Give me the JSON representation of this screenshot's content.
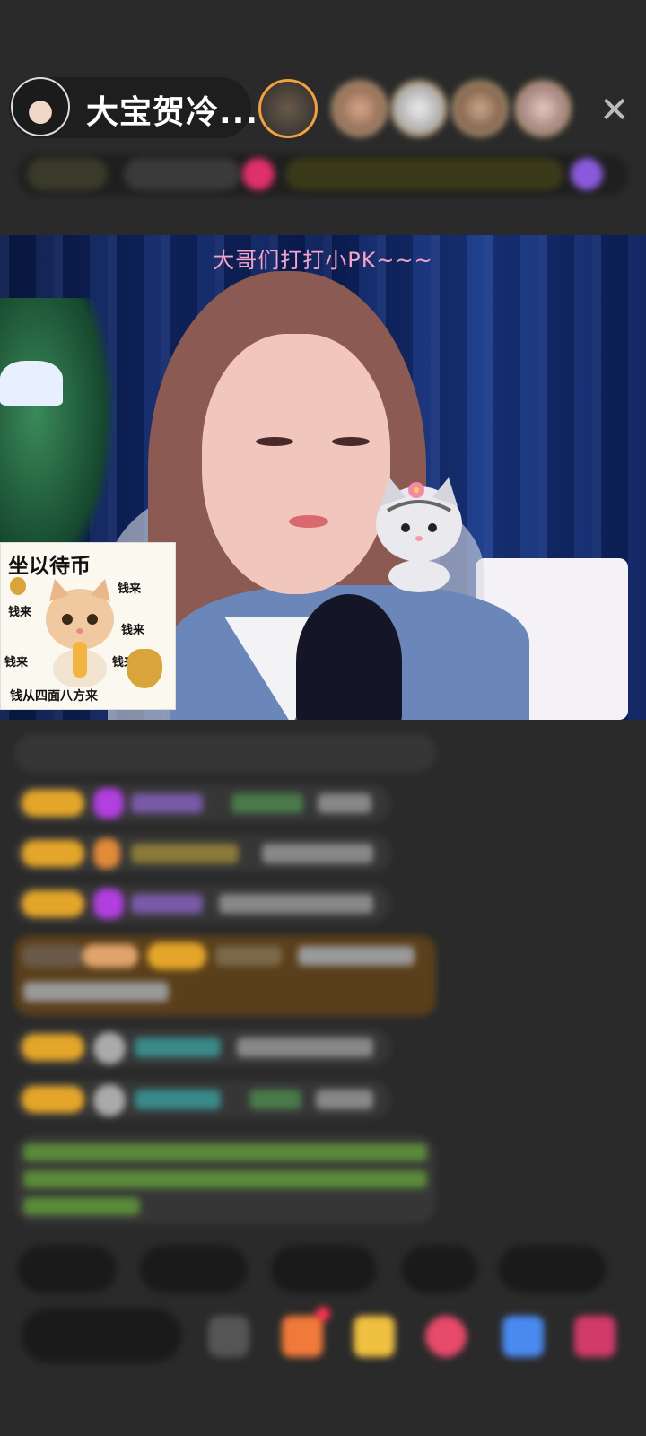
{
  "header": {
    "host_name": "大宝贺冷...",
    "close_icon": "close-icon",
    "viewer_count": 5
  },
  "video": {
    "caption": "大哥们打打小PK~~~",
    "sticker": {
      "title": "坐以待币",
      "words": [
        "钱来",
        "钱来",
        "钱来",
        "钱来",
        "钱来"
      ],
      "bottom": "钱从四面八方来"
    }
  },
  "chat": {
    "messages_count": 8
  },
  "colors": {
    "background": "#2a2a2a",
    "caption": "#f4a3c9",
    "badge": "#e4a62a",
    "gift_bubble": "#5a3f1b"
  },
  "bottom_bar": {
    "quick_replies_count": 5,
    "tools": [
      "face-icon",
      "gift-box-icon",
      "treasure-icon",
      "heart-icon",
      "game-icon",
      "more-gifts-icon"
    ]
  }
}
